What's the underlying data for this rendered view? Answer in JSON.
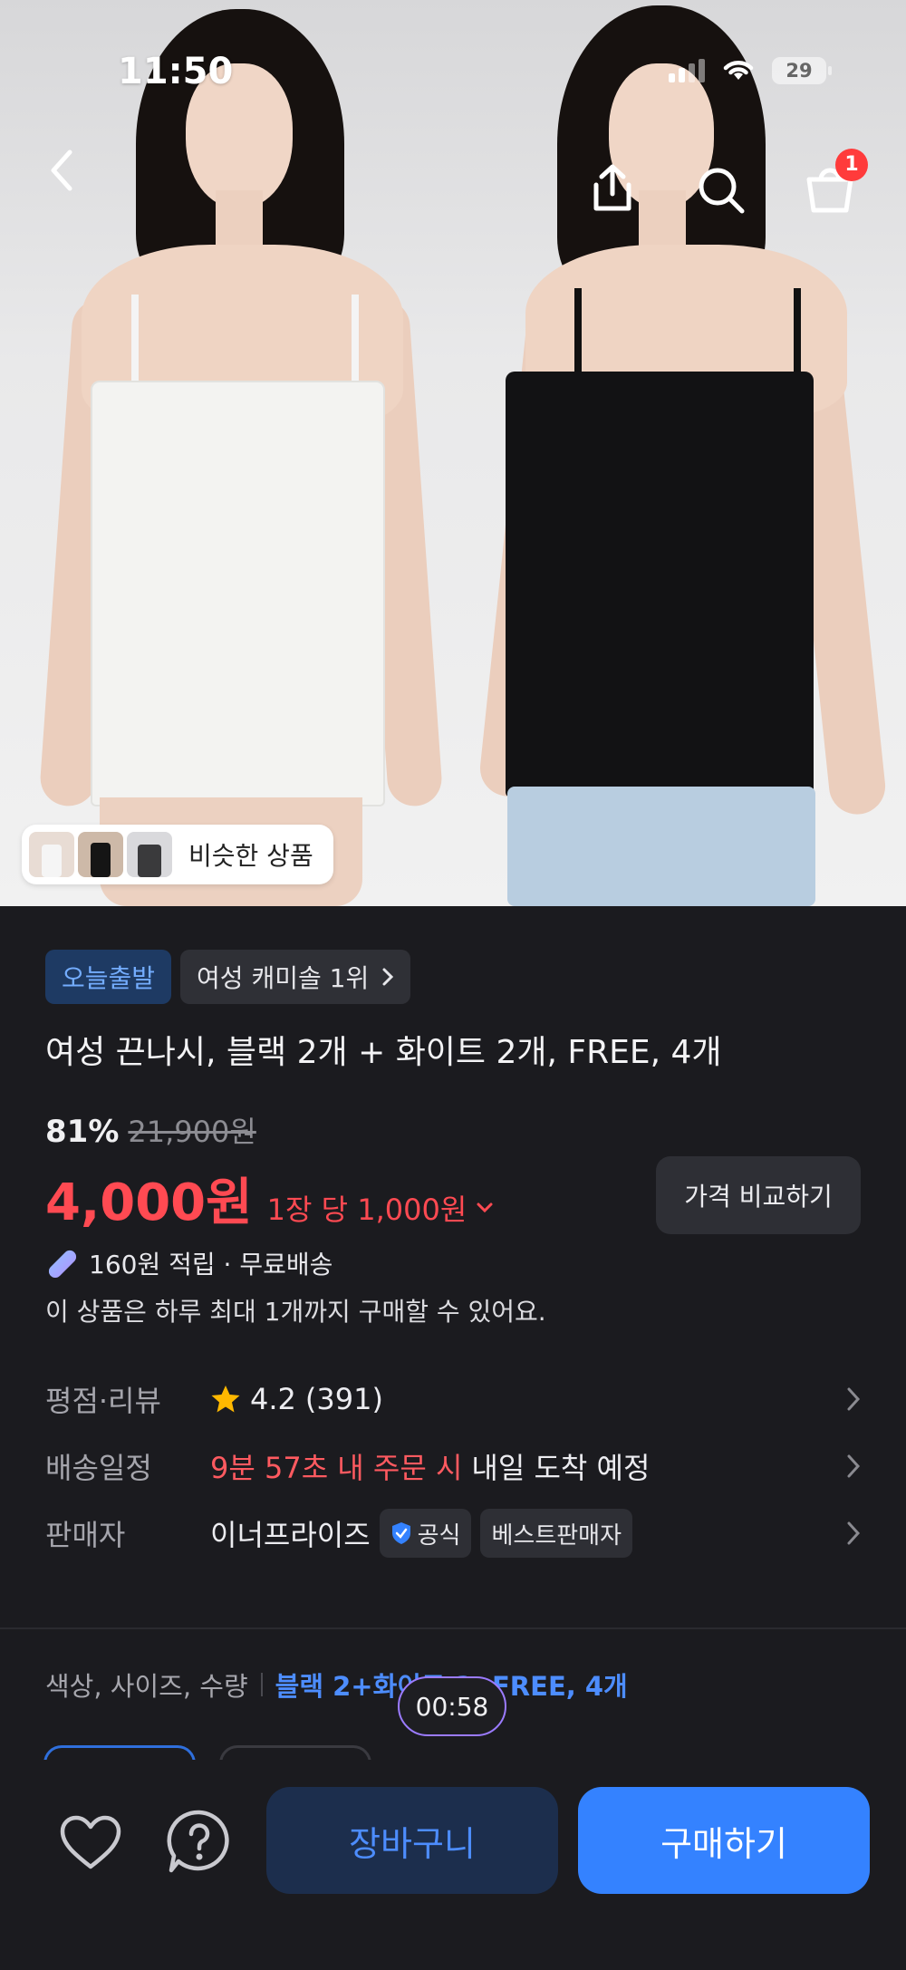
{
  "status_bar": {
    "time": "11:50",
    "battery": "29"
  },
  "top_nav": {
    "cart_count": "1"
  },
  "hero": {
    "similar_label": "비슷한 상품"
  },
  "product": {
    "badge_today": "오늘출발",
    "badge_rank": "여성 캐미솔 1위",
    "title": "여성 끈나시, 블랙 2개 + 화이트 2개, FREE, 4개",
    "discount": "81%",
    "original_price": "21,900원",
    "price": "4,000원",
    "unit_price": "1장 당 1,000원",
    "compare_button": "가격 비교하기",
    "points": "160원 적립 · 무료배송",
    "purchase_limit": "이 상품은 하루 최대 1개까지 구매할 수 있어요."
  },
  "details": {
    "rating_label": "평점·리뷰",
    "rating_value": "4.2",
    "rating_count": "(391)",
    "delivery_label": "배송일정",
    "delivery_countdown": "9분 57초 내 주문 시",
    "delivery_eta": "내일 도착 예정",
    "seller_label": "판매자",
    "seller_name": "이너프라이즈",
    "seller_official": "공식",
    "seller_best": "베스트판매자"
  },
  "options": {
    "label": "색상, 사이즈, 수량",
    "selected": "블랙 2+화이트 2, FREE, 4개",
    "timer": "00:58"
  },
  "bottom_bar": {
    "cart_button": "장바구니",
    "buy_button": "구매하기"
  },
  "colors": {
    "background": "#1b1b1f",
    "accent_blue": "#3482ff",
    "price_red": "#ff4a52"
  }
}
